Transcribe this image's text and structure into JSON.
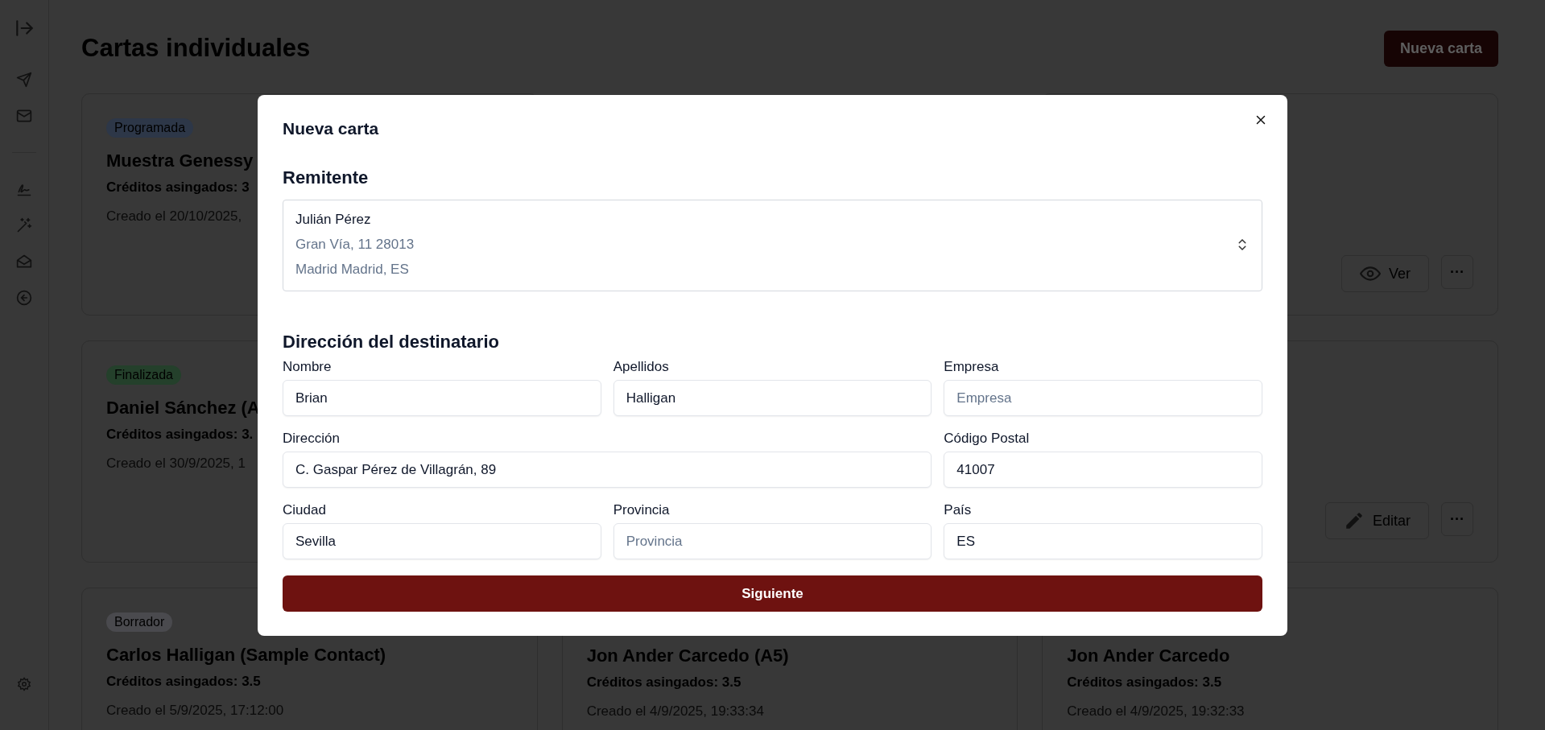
{
  "page": {
    "title": "Cartas individuales",
    "new_button": "Nueva carta"
  },
  "sidebar": {
    "items": [
      {
        "kind": "collapse"
      },
      {
        "kind": "send"
      },
      {
        "kind": "mail"
      },
      {
        "kind": "divider"
      },
      {
        "kind": "signature"
      },
      {
        "kind": "wand"
      },
      {
        "kind": "mail-open"
      },
      {
        "kind": "back"
      }
    ],
    "footer": {
      "kind": "settings"
    }
  },
  "card_columns": [
    {
      "cards": [
        {
          "badge": {
            "label": "Programada",
            "color": "#2d3748"
          },
          "title": "Muestra Genessy",
          "credits": "Créditos asingados: 3",
          "created": "Creado el 20/10/2025,"
        },
        {
          "badge": {
            "label": "Finalizada",
            "color": "#24402b"
          },
          "title": "Daniel Sánchez (A",
          "credits": "Créditos asingados: 3.",
          "created": "Creado el 30/9/2025, 1"
        },
        {
          "badge": {
            "label": "Borrador",
            "color": "#4a4a4e"
          },
          "title": "Carlos Halligan (Sample Contact)",
          "credits": "Créditos asingados: 3.5",
          "created": "Creado el 5/9/2025, 17:12:00"
        }
      ]
    },
    {
      "cards": [
        {
          "title": "Jon Ander Carcedo (A5)",
          "credits": "Créditos asingados: 3.5",
          "created": "Creado el 4/9/2025, 19:33:34"
        }
      ]
    },
    {
      "cards": [
        {
          "actions": [
            {
              "kind": "view",
              "label": "Ver"
            },
            {
              "kind": "more",
              "label": "···"
            }
          ]
        },
        {
          "actions": [
            {
              "kind": "edit",
              "label": "Editar"
            },
            {
              "kind": "more",
              "label": "···"
            }
          ]
        },
        {
          "title": "Jon Ander Carcedo",
          "credits": "Créditos asingados: 3.5",
          "created": "Creado el 4/9/2025, 19:32:33"
        }
      ]
    }
  ],
  "modal": {
    "title": "Nueva carta",
    "sender": {
      "heading": "Remitente",
      "name": "Julián Pérez",
      "lines": [
        "Gran Vía, 11 28013",
        "Madrid Madrid, ES"
      ]
    },
    "recipient": {
      "heading": "Dirección del destinatario",
      "fields": [
        {
          "label": "Nombre",
          "value": "Brian",
          "wide": false
        },
        {
          "label": "Apellidos",
          "value": "Halligan",
          "wide": false
        },
        {
          "label": "Empresa",
          "placeholder": "Empresa",
          "wide": false
        },
        {
          "label": "Dirección",
          "value": "C. Gaspar Pérez de Villagrán, 89",
          "wide": true
        },
        {
          "label": "Código Postal",
          "value": "41007",
          "wide": false
        },
        {
          "label": "Ciudad",
          "value": "Sevilla",
          "wide": false
        },
        {
          "label": "Provincia",
          "placeholder": "Provincia",
          "wide": false
        },
        {
          "label": "País",
          "value": "ES",
          "wide": false
        }
      ]
    },
    "submit": "Siguiente"
  }
}
